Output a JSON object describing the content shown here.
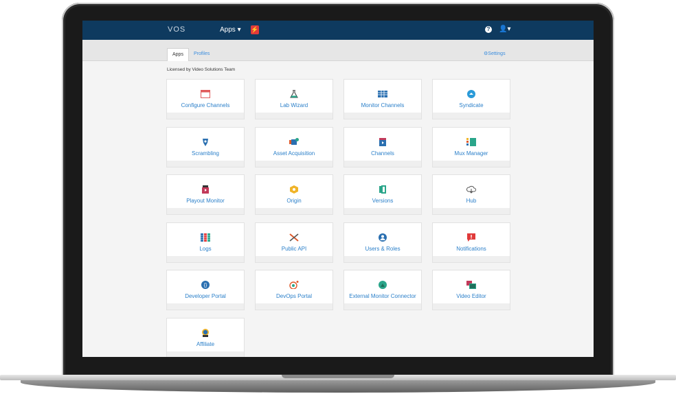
{
  "navbar": {
    "brand": "VOS",
    "apps_menu": "Apps ▾",
    "help": "?",
    "user": "👤▾"
  },
  "tabs": [
    "Apps",
    "Profiles"
  ],
  "settings_label": "⚙Settings",
  "licensed_text": "Licensed by Video Solutions Team",
  "apps": [
    {
      "label": "Configure Channels",
      "icon": "browser-window-icon",
      "color": "#e05a5a"
    },
    {
      "label": "Lab Wizard",
      "icon": "flask-icon",
      "color": "#2aa58a"
    },
    {
      "label": "Monitor Channels",
      "icon": "grid-monitor-icon",
      "color": "#2a6fb0"
    },
    {
      "label": "Syndicate",
      "icon": "syndicate-icon",
      "color": "#2a9ad8"
    },
    {
      "label": "Scrambling",
      "icon": "shield-icon",
      "color": "#2a6fb0"
    },
    {
      "label": "Asset Acquisition",
      "icon": "camera-check-icon",
      "color": "#2aa58a"
    },
    {
      "label": "Channels",
      "icon": "tv-play-icon",
      "color": "#2a6fb0"
    },
    {
      "label": "Mux Manager",
      "icon": "mux-icon",
      "color": "#2aa58a"
    },
    {
      "label": "Playout Monitor",
      "icon": "playout-icon",
      "color": "#c23a5a"
    },
    {
      "label": "Origin",
      "icon": "hexagon-icon",
      "color": "#f0b429"
    },
    {
      "label": "Versions",
      "icon": "versions-icon",
      "color": "#2aa58a"
    },
    {
      "label": "Hub",
      "icon": "cloud-icon",
      "color": "#555555"
    },
    {
      "label": "Logs",
      "icon": "logs-icon",
      "color": "#2a6fb0"
    },
    {
      "label": "Public API",
      "icon": "tools-icon",
      "color": "#e05a2a"
    },
    {
      "label": "Users & Roles",
      "icon": "user-circle-icon",
      "color": "#2a6fb0"
    },
    {
      "label": "Notifications",
      "icon": "chat-alert-icon",
      "color": "#e03a3a"
    },
    {
      "label": "Developer Portal",
      "icon": "braces-icon",
      "color": "#2a6fb0"
    },
    {
      "label": "DevOps Portal",
      "icon": "compass-icon",
      "color": "#e05a2a"
    },
    {
      "label": "External Monitor Connector",
      "icon": "triangle-circle-icon",
      "color": "#2aa58a"
    },
    {
      "label": "Video Editor",
      "icon": "film-icon",
      "color": "#2aa58a"
    },
    {
      "label": "Affiliate",
      "icon": "affiliate-icon",
      "color": "#2aa58a"
    }
  ]
}
